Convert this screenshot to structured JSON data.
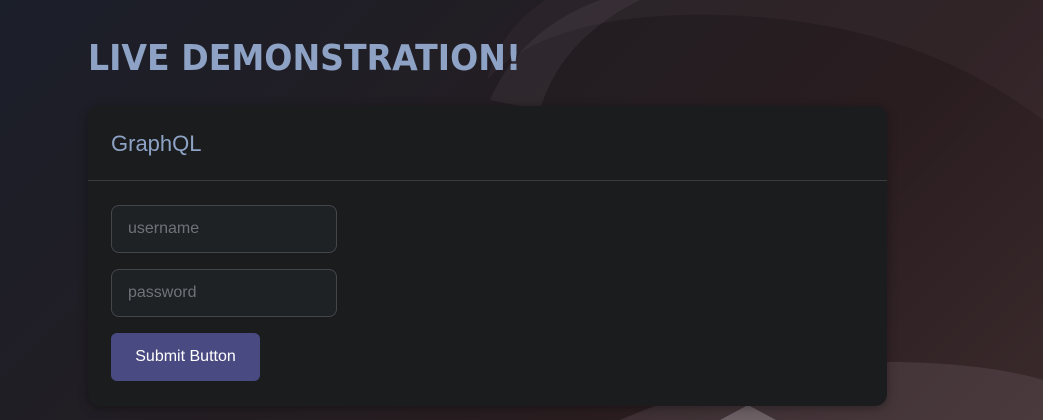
{
  "page": {
    "title": "LIVE DEMONSTRATION!"
  },
  "card": {
    "title": "GraphQL",
    "username": {
      "placeholder": "username",
      "value": ""
    },
    "password": {
      "placeholder": "password",
      "value": ""
    },
    "submit_label": "Submit Button"
  },
  "colors": {
    "title": "#8da2c4",
    "card_background": "#1b1c1e",
    "button": "#4a4a82"
  }
}
